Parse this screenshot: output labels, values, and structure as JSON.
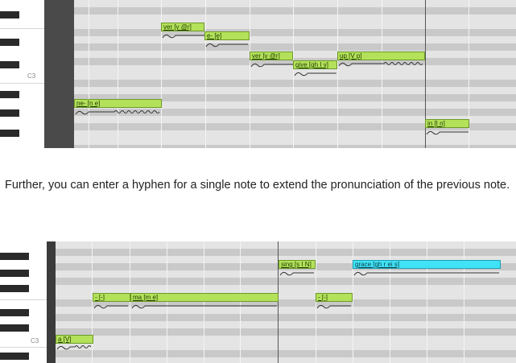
{
  "caption": "Further, you can enter a hyphen for a single note to extend the pronunciation of the previous note.",
  "editor1": {
    "octave_label": "C3",
    "notes": [
      "ver [v @r]",
      "e- [e]",
      "ver [v @r]",
      "give [gh I v]",
      "up [V p]",
      "ne- [n e]",
      "in [I n]"
    ]
  },
  "editor2": {
    "octave_label": "C3",
    "notes": [
      "sing [s I N]",
      "grace [gh r ei s]",
      "- [-]",
      "ma [m e]",
      "- [-]",
      "a [V]"
    ]
  },
  "colors": {
    "note_fill": "#b4e15a",
    "selected_note_fill": "#3fe3f5",
    "key_black": "#2a2a2a",
    "grid_dark": "#c9c9c9",
    "grid_light": "#e4e4e4"
  }
}
